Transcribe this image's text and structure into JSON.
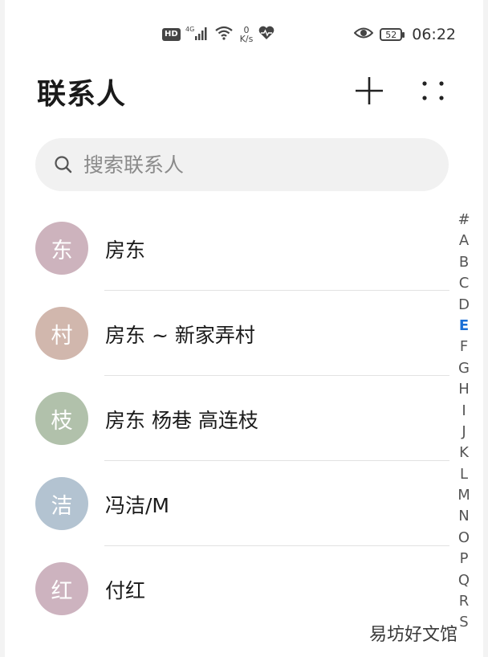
{
  "status_bar": {
    "hd_badge": "HD",
    "network_type": "4G",
    "speed_value": "0",
    "speed_unit": "K/s",
    "battery_level": "52",
    "time": "06:22"
  },
  "header": {
    "title": "联系人"
  },
  "search": {
    "placeholder": "搜索联系人"
  },
  "contacts": [
    {
      "avatar_char": "东",
      "name": "房东",
      "avatar_color": "#cdb3bd"
    },
    {
      "avatar_char": "村",
      "name": "房东 ~ 新家弄村",
      "avatar_color": "#d1b7ad"
    },
    {
      "avatar_char": "枝",
      "name": "房东 杨巷 高连枝",
      "avatar_color": "#b1c1ab"
    },
    {
      "avatar_char": "洁",
      "name": "冯洁/M",
      "avatar_color": "#b3c3d1"
    },
    {
      "avatar_char": "红",
      "name": "付红",
      "avatar_color": "#cdb3bf"
    }
  ],
  "alpha_index": [
    "#",
    "A",
    "B",
    "C",
    "D",
    "E",
    "F",
    "G",
    "H",
    "I",
    "J",
    "K",
    "L",
    "M",
    "N",
    "O",
    "P",
    "Q",
    "R",
    "S"
  ],
  "alpha_index_active": "E",
  "watermark": "易坊好文馆",
  "colors": {
    "accent": "#1a6fd6"
  }
}
